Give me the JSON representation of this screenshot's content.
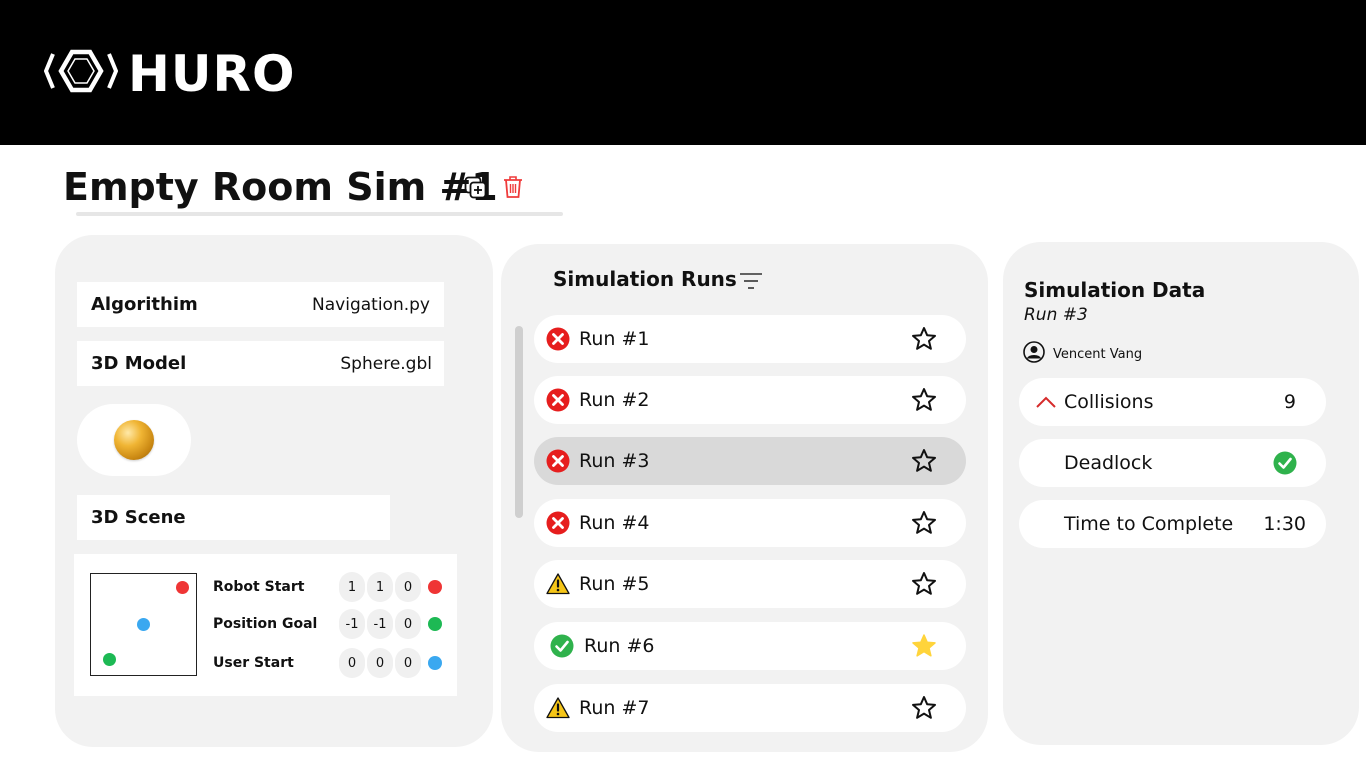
{
  "app": {
    "brand": "HURO"
  },
  "page": {
    "title": "Empty Room Sim #1",
    "duplicate_icon": "duplicate-icon",
    "delete_icon": "trash-icon"
  },
  "config": {
    "algorithm": {
      "label": "Algorithim",
      "value": "Navigation.py"
    },
    "model": {
      "label": "3D Model",
      "value": "Sphere.gbl"
    },
    "scene": {
      "label": "3D Scene"
    },
    "positions": [
      {
        "label": "Robot Start",
        "coords": [
          "1",
          "1",
          "0"
        ],
        "color": "#ef3535"
      },
      {
        "label": "Position Goal",
        "coords": [
          "-1",
          "-1",
          "0"
        ],
        "color": "#1db954"
      },
      {
        "label": "User Start",
        "coords": [
          "0",
          "0",
          "0"
        ],
        "color": "#3aa8f0"
      }
    ]
  },
  "runs": {
    "title": "Simulation Runs",
    "filter_icon": "filter-icon",
    "items": [
      {
        "label": "Run #1",
        "status": "failed",
        "starred": false,
        "selected": false
      },
      {
        "label": "Run #2",
        "status": "failed",
        "starred": false,
        "selected": false
      },
      {
        "label": "Run #3",
        "status": "failed",
        "starred": false,
        "selected": true
      },
      {
        "label": "Run #4",
        "status": "failed",
        "starred": false,
        "selected": false
      },
      {
        "label": "Run #5",
        "status": "warning",
        "starred": false,
        "selected": false
      },
      {
        "label": "Run #6",
        "status": "success",
        "starred": true,
        "selected": false
      },
      {
        "label": "Run #7",
        "status": "warning",
        "starred": false,
        "selected": false
      }
    ]
  },
  "details": {
    "title": "Simulation Data",
    "subtitle": "Run #3",
    "user": "Vencent Vang",
    "metrics": {
      "collisions": {
        "label": "Collisions",
        "value": "9"
      },
      "deadlock": {
        "label": "Deadlock"
      },
      "time": {
        "label": "Time to Complete",
        "value": "1:30"
      }
    }
  },
  "colors": {
    "failed": "#e61e1e",
    "warning": "#f5c518",
    "success": "#2fb24c",
    "star_filled": "#ffd43b"
  }
}
